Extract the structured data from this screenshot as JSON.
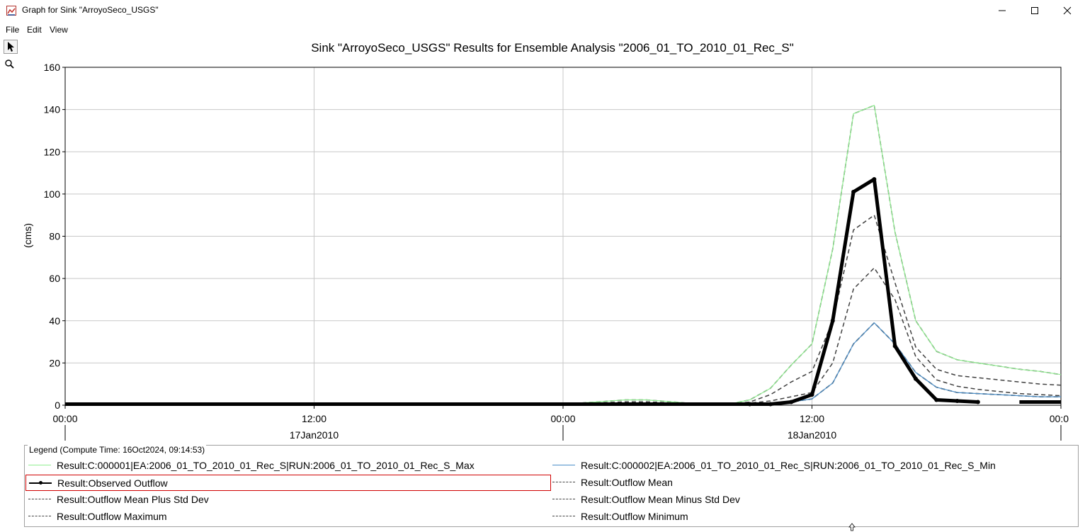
{
  "window": {
    "title": "Graph for Sink \"ArroyoSeco_USGS\""
  },
  "menu": [
    "File",
    "Edit",
    "View"
  ],
  "toolbar": {
    "tools": [
      "pointer-icon",
      "zoom-icon"
    ]
  },
  "chart_data": {
    "type": "line",
    "title": "Sink \"ArroyoSeco_USGS\" Results for Ensemble Analysis \"2006_01_TO_2010_01_Rec_S\"",
    "ylabel": "(cms)",
    "xlabel": "",
    "ylim": [
      0,
      160
    ],
    "yticks": [
      0,
      20,
      40,
      60,
      80,
      100,
      120,
      140,
      160
    ],
    "xlim_hours": [
      0,
      48
    ],
    "xticks": [
      {
        "hour": 0,
        "label": "00:00"
      },
      {
        "hour": 12,
        "label": "12:00"
      },
      {
        "hour": 24,
        "label": "00:00"
      },
      {
        "hour": 36,
        "label": "12:00"
      },
      {
        "hour": 48,
        "label": "00:0"
      }
    ],
    "date_labels": [
      {
        "hour": 12,
        "label": "17Jan2010"
      },
      {
        "hour": 36,
        "label": "18Jan2010"
      }
    ],
    "grid": true,
    "series": [
      {
        "name": "Result:C:000001|EA:2006_01_TO_2010_01_Rec_S|RUN:2006_01_TO_2010_01_Rec_S_Max",
        "color": "#90ee90",
        "dash": "",
        "width": 1.2,
        "x": [
          0,
          24,
          26,
          27,
          28,
          29,
          30,
          31,
          32,
          33,
          34,
          35,
          36,
          37,
          38,
          39,
          40,
          41,
          42,
          43,
          44,
          45,
          46,
          47,
          48
        ],
        "y": [
          0.5,
          0.5,
          1.8,
          2.5,
          2.5,
          1.8,
          1,
          0.5,
          0.5,
          2.5,
          8,
          19,
          29,
          74,
          138,
          142,
          82,
          40,
          25.5,
          21.5,
          20,
          18.5,
          17,
          16,
          14.5
        ]
      },
      {
        "name": "Result:C:000002|EA:2006_01_TO_2010_01_Rec_S|RUN:2006_01_TO_2010_01_Rec_S_Min",
        "color": "#4a8ec8",
        "dash": "",
        "width": 1.2,
        "x": [
          0,
          24,
          31,
          32,
          33,
          34,
          35,
          36,
          37,
          38,
          39,
          40,
          41,
          42,
          43,
          44,
          45,
          46,
          47,
          48
        ],
        "y": [
          0.3,
          0.3,
          0.3,
          0.4,
          0.6,
          1,
          1.5,
          3,
          10.5,
          29,
          39,
          29,
          15.5,
          8.5,
          6,
          5.5,
          5,
          4.5,
          4,
          4
        ]
      },
      {
        "name": "Result:Observed Outflow",
        "color": "#000000",
        "dash": "",
        "width": 5,
        "x": [
          0,
          33,
          34,
          35,
          36,
          37,
          38,
          39,
          40,
          41,
          42,
          43,
          44
        ],
        "y": [
          0.5,
          0.5,
          0.5,
          1.5,
          5,
          40,
          101,
          107,
          28,
          12.5,
          2.5,
          2,
          1.5
        ]
      },
      {
        "name": "Result:Outflow Mean",
        "color": "#404040",
        "dash": "6,4",
        "width": 1.5,
        "x": [
          0,
          24,
          31,
          32,
          33,
          34,
          35,
          36,
          37,
          38,
          39,
          40,
          41,
          42,
          43,
          44,
          45,
          46,
          47,
          48
        ],
        "y": [
          0.5,
          0.5,
          0.5,
          0.6,
          1,
          2,
          4,
          6,
          20,
          55,
          65,
          50,
          23,
          12,
          9,
          7.5,
          6.5,
          5.5,
          5,
          4.5
        ]
      },
      {
        "name": "Result:Outflow Mean Plus Std Dev",
        "color": "#404040",
        "dash": "6,4",
        "width": 1.5,
        "x": [
          0,
          24,
          26,
          27,
          28,
          29,
          30,
          31,
          32,
          33,
          34,
          35,
          36,
          37,
          38,
          39,
          40,
          41,
          42,
          43,
          44,
          45,
          46,
          47,
          48
        ],
        "y": [
          0.5,
          0.5,
          1.2,
          1.6,
          1.6,
          1.2,
          0.8,
          0.5,
          0.5,
          1.5,
          5,
          11,
          16,
          40,
          83,
          90,
          58,
          27.5,
          17,
          14,
          13,
          12,
          11,
          10,
          9.5
        ]
      },
      {
        "name": "Result:Outflow Mean Minus Std Dev",
        "color": "#404040",
        "dash": "6,4",
        "width": 1.5,
        "x": [
          0,
          24,
          31,
          32,
          33,
          34,
          35,
          36,
          37,
          38,
          39,
          40,
          41,
          42,
          43,
          44,
          45,
          46,
          47,
          48
        ],
        "y": [
          0.3,
          0.3,
          0.3,
          0.4,
          0.6,
          1,
          1.5,
          3,
          10.5,
          29,
          39,
          29,
          15.5,
          8.5,
          6,
          5.5,
          5,
          4.5,
          4,
          4
        ]
      },
      {
        "name": "Result:Outflow Maximum",
        "color": "#404040",
        "dash": "6,4",
        "width": 1.5,
        "x": [
          0,
          24,
          26,
          27,
          28,
          29,
          30,
          31,
          32,
          33,
          34,
          35,
          36,
          37,
          38,
          39,
          40,
          41,
          42,
          43,
          44,
          45,
          46,
          47,
          48
        ],
        "y": [
          0.5,
          0.5,
          1.8,
          2.5,
          2.5,
          1.8,
          1,
          0.5,
          0.5,
          2.5,
          8,
          19,
          29,
          74,
          138,
          142,
          82,
          40,
          25.5,
          21.5,
          20,
          18.5,
          17,
          16,
          14.5
        ]
      },
      {
        "name": "Result:Outflow Minimum",
        "color": "#404040",
        "dash": "6,4",
        "width": 1.5,
        "x": [
          0,
          24,
          31,
          32,
          33,
          34,
          35,
          36,
          37,
          38,
          39,
          40,
          41,
          42,
          43,
          44,
          45,
          46,
          47,
          48
        ],
        "y": [
          0.3,
          0.3,
          0.3,
          0.4,
          0.6,
          1,
          1.5,
          3,
          10.5,
          29,
          39,
          29,
          15.5,
          8.5,
          6,
          5.5,
          5,
          4.5,
          4,
          4
        ]
      }
    ],
    "observed_extra": {
      "x": [
        46,
        48
      ],
      "y": [
        1.5,
        1.5
      ]
    }
  },
  "legend": {
    "title": "Legend (Compute Time: 16Oct2024, 09:14:53)",
    "items": [
      {
        "label": "Result:C:000001|EA:2006_01_TO_2010_01_Rec_S|RUN:2006_01_TO_2010_01_Rec_S_Max",
        "color": "#90ee90",
        "style": "solid"
      },
      {
        "label": "Result:C:000002|EA:2006_01_TO_2010_01_Rec_S|RUN:2006_01_TO_2010_01_Rec_S_Min",
        "color": "#4a8ec8",
        "style": "solid"
      },
      {
        "label": "Result:Observed Outflow",
        "color": "#000000",
        "style": "marker"
      },
      {
        "label": "Result:Outflow Mean",
        "color": "#404040",
        "style": "dashed"
      },
      {
        "label": "Result:Outflow Mean Plus Std Dev",
        "color": "#404040",
        "style": "dashed"
      },
      {
        "label": "Result:Outflow Mean Minus Std Dev",
        "color": "#404040",
        "style": "dashed"
      },
      {
        "label": "Result:Outflow Maximum",
        "color": "#404040",
        "style": "dashed"
      },
      {
        "label": "Result:Outflow Minimum",
        "color": "#404040",
        "style": "dashed"
      }
    ]
  }
}
